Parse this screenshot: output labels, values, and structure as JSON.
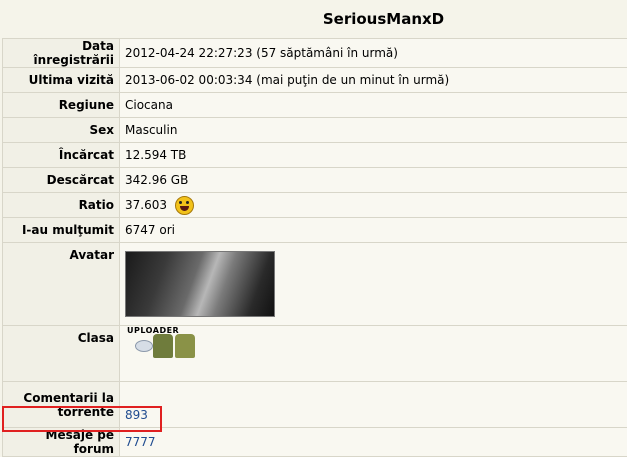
{
  "username": "SeriousManxD",
  "rows": {
    "registered": {
      "label": "Data înregistrării",
      "value": "2012-04-24 22:27:23 (57 săptămâni în urmă)"
    },
    "last_visit": {
      "label": "Ultima vizită",
      "value": "2013-06-02 00:03:34 (mai puţin de un minut în urmă)"
    },
    "region": {
      "label": "Regiune",
      "value": "Ciocana"
    },
    "sex": {
      "label": "Sex",
      "value": "Masculin"
    },
    "uploaded": {
      "label": "Încărcat",
      "value": "12.594 TB"
    },
    "downloaded": {
      "label": "Descărcat",
      "value": "342.96 GB"
    },
    "ratio": {
      "label": "Ratio",
      "value": "37.603"
    },
    "thanked": {
      "label": "I-au mulţumit",
      "value": "6747 ori"
    },
    "avatar": {
      "label": "Avatar"
    },
    "class": {
      "label": "Clasa",
      "badge_text": "UPLOADER"
    },
    "comments": {
      "label": "Comentarii la torrente",
      "value": "893"
    },
    "forum_posts": {
      "label": "Mesaje pe forum",
      "value": "7777"
    }
  },
  "colors": {
    "background": "#f5f4ea",
    "link": "#1f4b8f",
    "highlight": "#e02020"
  }
}
